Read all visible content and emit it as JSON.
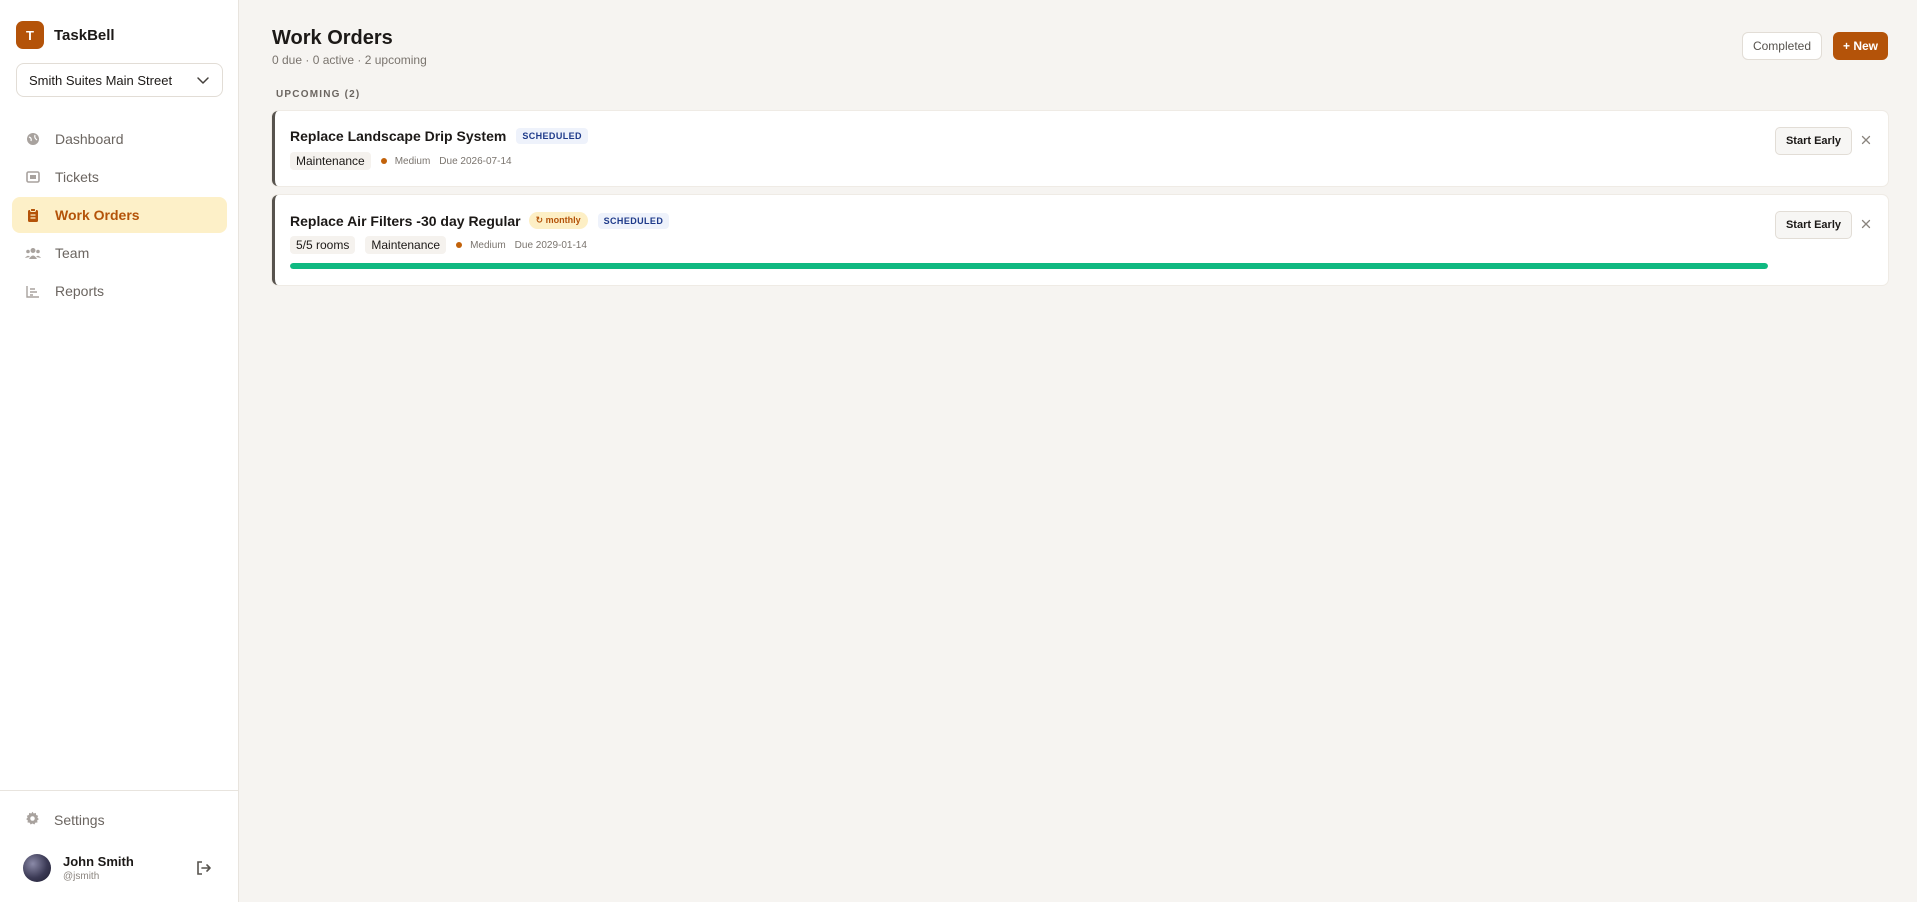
{
  "brand": {
    "initial": "T",
    "name": "TaskBell"
  },
  "location": {
    "selected": "Smith Suites Main Street"
  },
  "nav": {
    "items": [
      {
        "label": "Dashboard",
        "icon": "globe-icon"
      },
      {
        "label": "Tickets",
        "icon": "ticket-icon"
      },
      {
        "label": "Work Orders",
        "icon": "clipboard-icon",
        "active": true
      },
      {
        "label": "Team",
        "icon": "users-icon"
      },
      {
        "label": "Reports",
        "icon": "bar-chart-icon"
      }
    ],
    "settings_label": "Settings"
  },
  "user": {
    "name": "John Smith",
    "handle": "@jsmith"
  },
  "header": {
    "title": "Work Orders",
    "subtitle": "0 due · 0 active · 2 upcoming",
    "completed_label": "Completed",
    "new_label": "+ New"
  },
  "upcoming": {
    "label": "UPCOMING (2)",
    "orders": [
      {
        "title": "Replace Landscape Drip System",
        "status": "SCHEDULED",
        "category": "Maintenance",
        "priority": "Medium",
        "due": "Due 2026-07-14",
        "action_label": "Start Early"
      },
      {
        "title": "Replace Air Filters -30 day Regular",
        "recurrence": "↻ monthly",
        "status": "SCHEDULED",
        "rooms": "5/5 rooms",
        "category": "Maintenance",
        "priority": "Medium",
        "due": "Due 2029-01-14",
        "progress": 1.0,
        "action_label": "Start Early"
      }
    ]
  },
  "colors": {
    "accent": "#b45309",
    "active_bg": "#fdf0c8",
    "progress": "#10b981",
    "status_text": "#1e3a8a"
  }
}
